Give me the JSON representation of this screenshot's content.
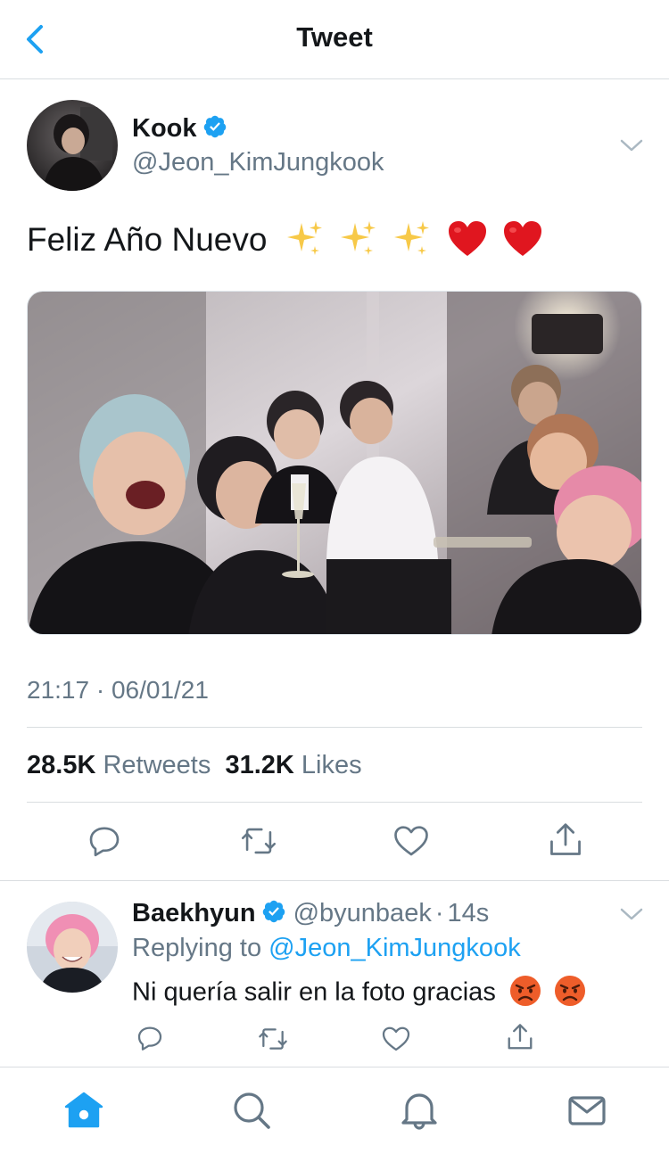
{
  "header": {
    "title": "Tweet",
    "back_icon": "chevron-left-icon"
  },
  "tweet": {
    "author": {
      "name": "Kook",
      "handle": "@Jeon_KimJungkook",
      "verified": true
    },
    "text": "Feliz Año Nuevo",
    "emojis": [
      "sparkles",
      "sparkles",
      "sparkles",
      "red-heart",
      "red-heart"
    ],
    "timestamp": "21:17 · 06/01/21",
    "stats": {
      "retweets_count": "28.5K",
      "retweets_label": "Retweets",
      "likes_count": "31.2K",
      "likes_label": "Likes"
    },
    "actions": [
      "reply-icon",
      "retweet-icon",
      "like-icon",
      "share-icon"
    ]
  },
  "reply": {
    "author": {
      "name": "Baekhyun",
      "handle": "@byunbaek",
      "verified": true
    },
    "time": "14s",
    "separator": "·",
    "replying_prefix": "Replying to",
    "replying_to": "@Jeon_KimJungkook",
    "text": "Ni quería salir en la foto gracias",
    "emojis": [
      "angry-face",
      "angry-face"
    ],
    "actions": [
      "reply-icon",
      "retweet-icon",
      "like-icon",
      "share-icon"
    ]
  },
  "tabbar": {
    "items": [
      "home-icon",
      "search-icon",
      "notifications-icon",
      "messages-icon"
    ],
    "active": "home-icon"
  },
  "colors": {
    "accent": "#1da1f2",
    "text": "#14171a",
    "secondary": "#657786",
    "divider": "#d9dde0"
  }
}
